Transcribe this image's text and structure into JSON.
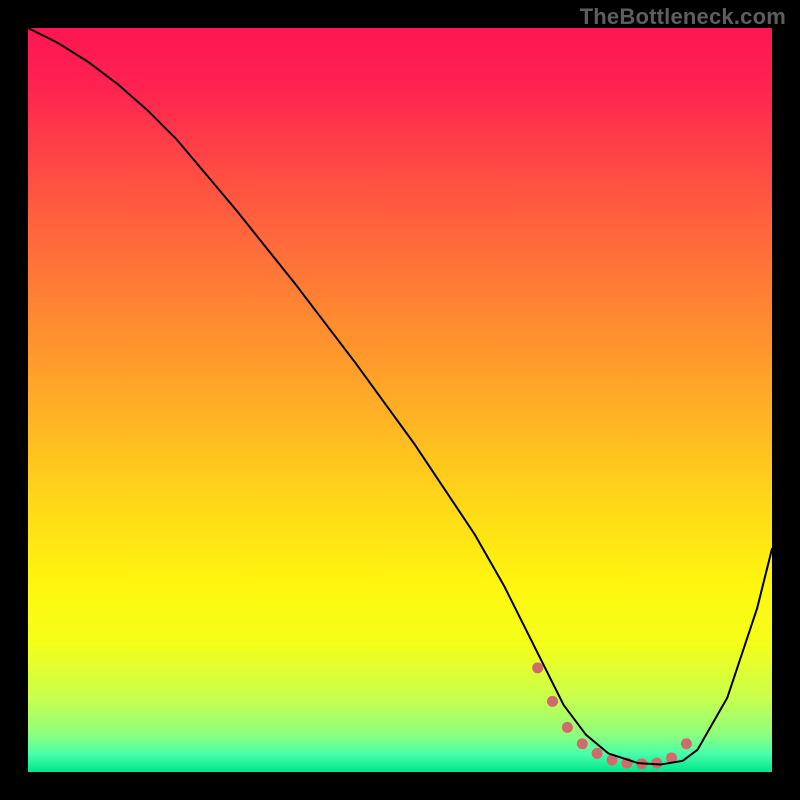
{
  "watermark": "TheBottleneck.com",
  "chart_data": {
    "type": "line",
    "title": "",
    "xlabel": "",
    "ylabel": "",
    "xlim": [
      0,
      100
    ],
    "ylim": [
      0,
      100
    ],
    "grid": false,
    "axes_visible": false,
    "background": {
      "type": "vertical-gradient",
      "stops": [
        {
          "offset": 0.0,
          "color": "#ff1552"
        },
        {
          "offset": 0.08,
          "color": "#ff2350"
        },
        {
          "offset": 0.2,
          "color": "#ff4e43"
        },
        {
          "offset": 0.34,
          "color": "#ff7a36"
        },
        {
          "offset": 0.48,
          "color": "#ffa528"
        },
        {
          "offset": 0.62,
          "color": "#ffd21a"
        },
        {
          "offset": 0.75,
          "color": "#fff70f"
        },
        {
          "offset": 0.83,
          "color": "#f4ff1a"
        },
        {
          "offset": 0.9,
          "color": "#c9ff4d"
        },
        {
          "offset": 0.95,
          "color": "#8dff7d"
        },
        {
          "offset": 0.975,
          "color": "#4affaa"
        },
        {
          "offset": 1.0,
          "color": "#00e58a"
        }
      ]
    },
    "series": [
      {
        "name": "bottleneck-curve",
        "stroke": "#000000",
        "stroke_width": 2,
        "x": [
          0,
          4,
          8,
          12,
          16,
          20,
          28,
          36,
          44,
          52,
          60,
          64,
          68,
          70,
          72,
          75,
          78,
          82,
          85,
          88,
          90,
          94,
          98,
          100
        ],
        "y": [
          100,
          98,
          95.5,
          92.5,
          89,
          85,
          75.5,
          65.5,
          55,
          44,
          32,
          25,
          17,
          13,
          9,
          5,
          2.5,
          1.2,
          1.0,
          1.5,
          3.0,
          10,
          22,
          30
        ]
      }
    ],
    "marker_region": {
      "name": "optimal-zone",
      "color": "#d16a6a",
      "marker_radius": 5.5,
      "x": [
        68.5,
        70.5,
        72.5,
        74.5,
        76.5,
        78.5,
        80.5,
        82.5,
        84.5,
        86.5,
        88.5
      ],
      "y": [
        14.0,
        9.5,
        6.0,
        3.8,
        2.5,
        1.6,
        1.2,
        1.1,
        1.2,
        1.9,
        3.8
      ]
    }
  }
}
